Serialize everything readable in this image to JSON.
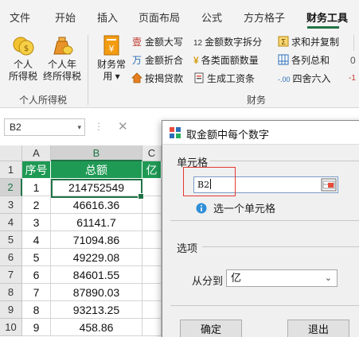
{
  "ribbon_tabs": [
    "文件",
    "开始",
    "插入",
    "页面布局",
    "公式",
    "方方格子",
    "财务工具"
  ],
  "ribbon": {
    "group_personal_tax": {
      "label": "个人所得税",
      "btn_tax": [
        "个人",
        "所得税"
      ],
      "btn_year_end": [
        "个人年",
        "终所得税"
      ]
    },
    "group_finance": {
      "label": "财务",
      "btn_common": [
        "财务常",
        "用 ▾"
      ],
      "small": [
        "金额大写",
        "金额折合",
        "按揭贷款",
        "金额数字拆分",
        "各类面额数量",
        "生成工资条",
        "求和并复制",
        "各列总和",
        "四舍六入"
      ],
      "small_icon_texts": {
        "split": "12",
        "count": "¥",
        "round": "-.00"
      },
      "edge_labels": [
        "0",
        "-1"
      ]
    }
  },
  "formula_bar": {
    "name_box": "B2",
    "dropdown": "▾",
    "separator": "⋮",
    "cancel": "✕"
  },
  "sheet": {
    "col_headers": [
      "A",
      "B",
      "C"
    ],
    "row_headers": [
      "1",
      "2",
      "3",
      "4",
      "5",
      "6",
      "7",
      "8",
      "9",
      "10"
    ],
    "header_row": [
      "序号",
      "总额",
      "亿"
    ],
    "rows": [
      [
        "1",
        "214752549"
      ],
      [
        "2",
        "46616.36"
      ],
      [
        "3",
        "61141.7"
      ],
      [
        "4",
        "71094.86"
      ],
      [
        "5",
        "49229.08"
      ],
      [
        "6",
        "84601.55"
      ],
      [
        "7",
        "87890.03"
      ],
      [
        "8",
        "93213.25"
      ],
      [
        "9",
        "458.86"
      ]
    ]
  },
  "dialog": {
    "title": "取金额中每个数字",
    "cell_section": "单元格",
    "cell_value": "B2",
    "hint": "选一个单元格",
    "options_section": "选项",
    "split_label": "从分到",
    "split_value": "亿",
    "select_arrow": "⌄",
    "ok_label": "确定",
    "exit_label": "退出"
  },
  "colors": {
    "accent": "#217346",
    "table_header": "#1f9a55",
    "highlight": "#e53935"
  }
}
